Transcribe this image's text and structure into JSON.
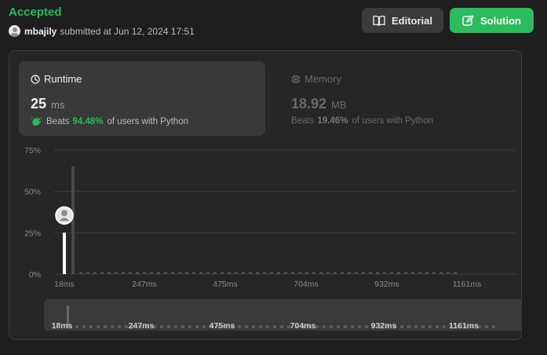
{
  "header": {
    "status": "Accepted",
    "username": "mbajily",
    "submitted_text": "submitted at Jun 12, 2024 17:51",
    "editorial_label": "Editorial",
    "solution_label": "Solution"
  },
  "runtime": {
    "label": "Runtime",
    "value": "25",
    "unit": "ms",
    "beats_label": "Beats",
    "beats_pct": "94.48%",
    "beats_suffix": "of users with Python",
    "icon": "clock-icon"
  },
  "memory": {
    "label": "Memory",
    "value": "18.92",
    "unit": "MB",
    "beats_label": "Beats",
    "beats_pct": "19.46%",
    "beats_suffix": "of users with Python",
    "icon": "chip-icon"
  },
  "colors": {
    "accent": "#2cbb5d",
    "bar": "#4a4a4a",
    "highlight_bar": "#ffffff"
  },
  "chart_data": {
    "type": "bar",
    "x_ticks": [
      "18ms",
      "247ms",
      "475ms",
      "704ms",
      "932ms",
      "1161ms"
    ],
    "y_ticks": [
      "75%",
      "50%",
      "25%",
      "0%"
    ],
    "ylim": [
      0,
      75
    ],
    "bars": [
      {
        "x": 18,
        "value": 25,
        "highlight": true
      },
      {
        "x": 22,
        "value": 65,
        "highlight": false
      }
    ],
    "bin_count": 54,
    "min_value": 1,
    "user_marker_x": 18,
    "navigator_ticks": [
      "18ms",
      "247ms",
      "475ms",
      "704ms",
      "932ms",
      "1161ms"
    ]
  }
}
